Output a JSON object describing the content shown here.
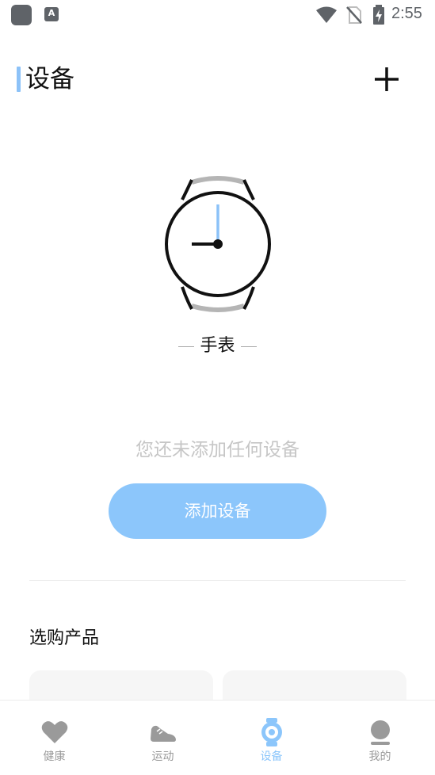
{
  "status_bar": {
    "time": "2:55",
    "notification_icon_letter": "A",
    "icons": [
      "app-notification-icon",
      "text-notification-icon",
      "wifi-icon",
      "no-sim-icon",
      "battery-charging-icon"
    ]
  },
  "header": {
    "title": "设备",
    "add_icon": "plus-icon"
  },
  "device_type": {
    "label": "手表",
    "icon": "watch-icon"
  },
  "empty_state": {
    "message": "您还未添加任何设备",
    "button_label": "添加设备"
  },
  "shop": {
    "title": "选购产品"
  },
  "bottom_nav": {
    "items": [
      {
        "label": "健康",
        "icon": "heart-icon",
        "active": false
      },
      {
        "label": "运动",
        "icon": "sneaker-icon",
        "active": false
      },
      {
        "label": "设备",
        "icon": "watch-icon",
        "active": true
      },
      {
        "label": "我的",
        "icon": "profile-icon",
        "active": false
      }
    ]
  },
  "colors": {
    "accent": "#8cc6fb",
    "title_accent": "#8cc2f8",
    "muted_text": "#c6c6c6",
    "nav_inactive": "#9a9a9a",
    "status_icons": "#5f6368"
  }
}
